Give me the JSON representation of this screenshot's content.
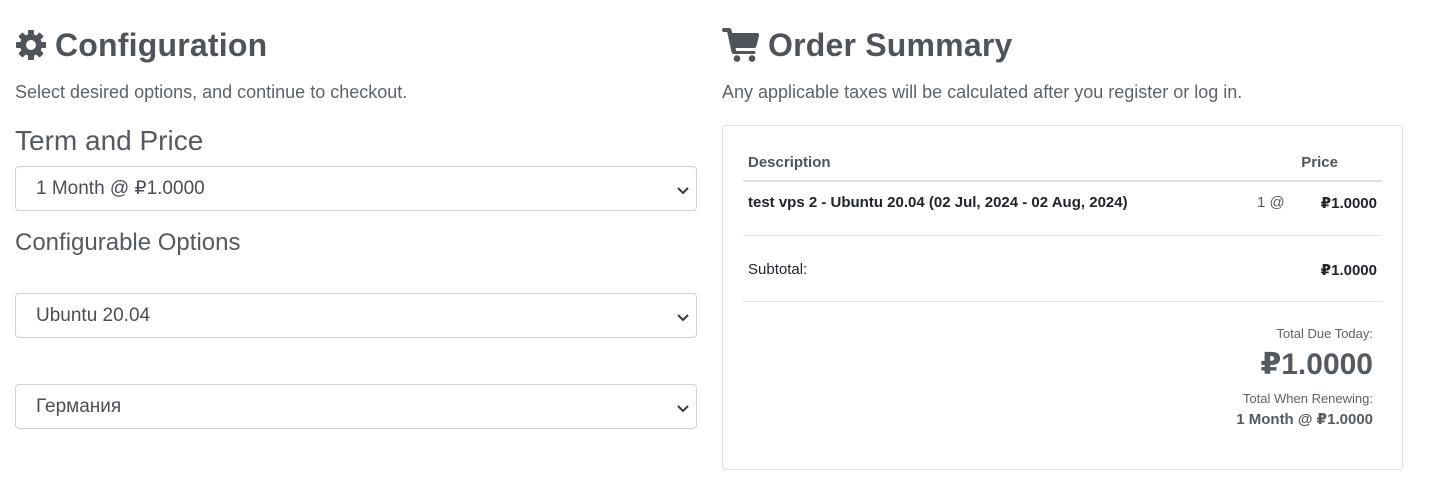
{
  "configuration": {
    "icon": "gear-icon",
    "title": "Configuration",
    "subtitle": "Select desired options, and continue to checkout.",
    "term_title": "Term and Price",
    "term_select": "1 Month @ ₽1.0000",
    "options_title": "Configurable Options",
    "os_select": "Ubuntu 20.04",
    "location_select": "Германия"
  },
  "order_summary": {
    "icon": "shopping-cart-icon",
    "title": "Order Summary",
    "subtitle": "Any applicable taxes will be calculated after you register or log in.",
    "table": {
      "col_description": "Description",
      "col_price": "Price",
      "item_name": "test vps 2 - Ubuntu 20.04 (02 Jul, 2024 - 02 Aug, 2024)",
      "item_qty": "1 @",
      "item_price": "₽1.0000",
      "subtotal_label": "Subtotal:",
      "subtotal_value": "₽1.0000"
    },
    "total_due_label": "Total Due Today:",
    "total_due_value": "₽1.0000",
    "total_renewing_label": "Total When Renewing:",
    "total_renewing_value": "1 Month @ ₽1.0000"
  },
  "colors": {
    "text": "#555a61",
    "border": "#cfd3d8"
  }
}
